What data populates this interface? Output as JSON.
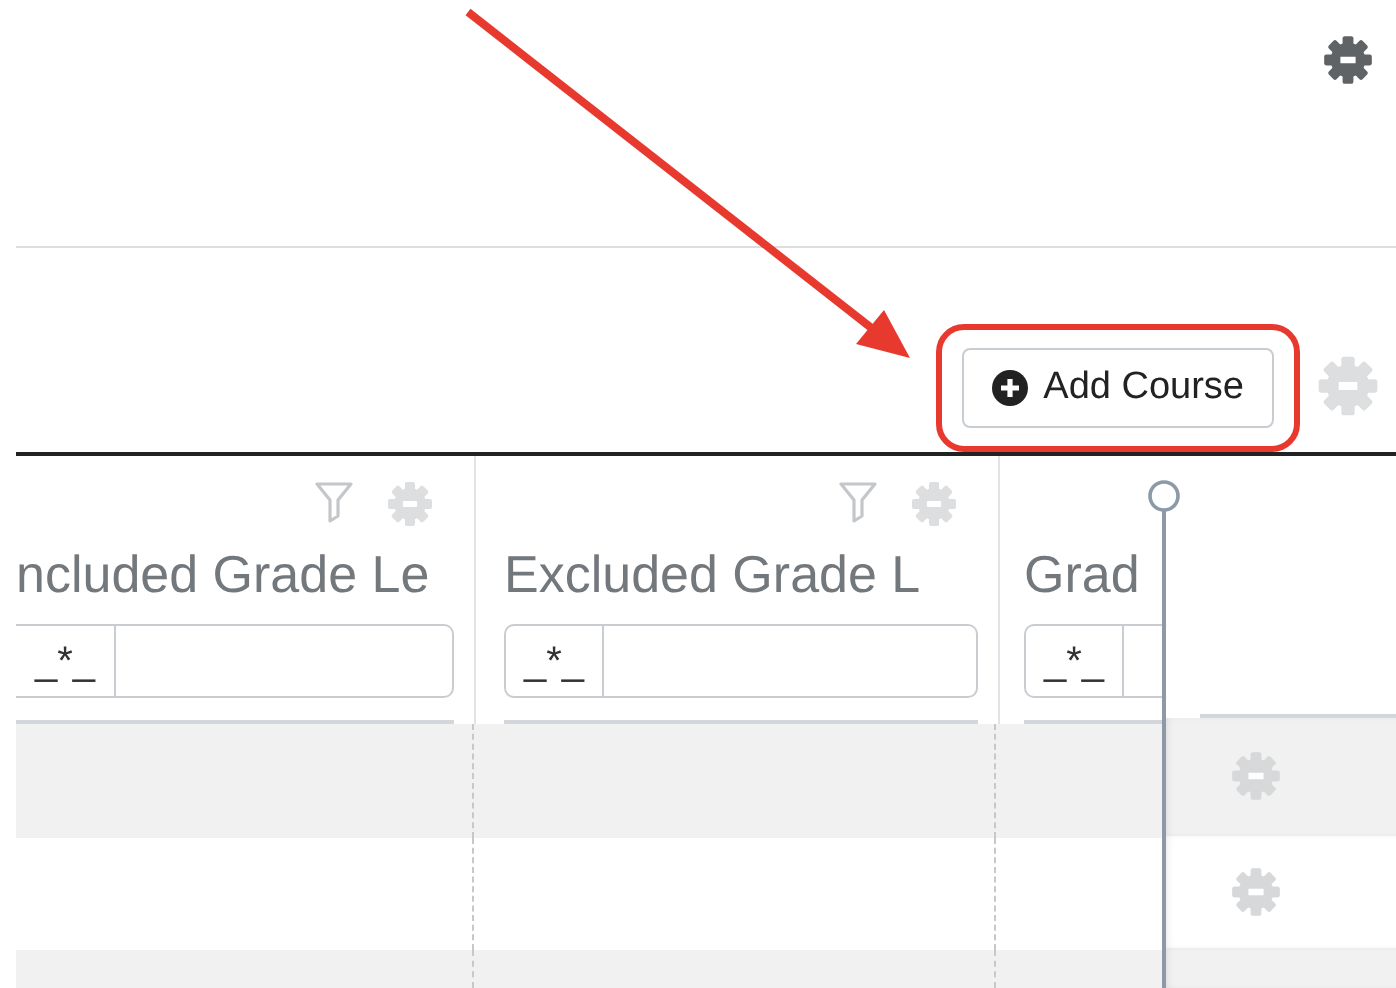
{
  "top_settings": {
    "disabled": false
  },
  "toolbar": {
    "add_button": {
      "label": "Add Course"
    },
    "grid_settings": {
      "disabled": true
    }
  },
  "columns": [
    {
      "title": "ncluded Grade Le",
      "operator": "_*_"
    },
    {
      "title": "Excluded Grade L",
      "operator": "_*_"
    },
    {
      "title": "Grad",
      "operator": "_*_"
    }
  ],
  "rows": [
    {
      "kind": "action"
    },
    {
      "kind": "action"
    },
    {
      "kind": "blank"
    }
  ],
  "annotations": {
    "arrow": true,
    "highlight": true
  }
}
